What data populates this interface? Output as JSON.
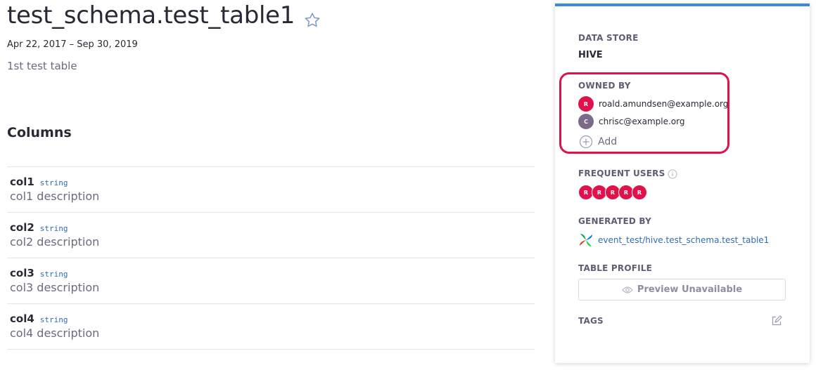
{
  "header": {
    "title": "test_schema.test_table1",
    "date_range": "Apr 22, 2017 – Sep 30, 2019",
    "description": "1st test table",
    "star_icon": "star-outline-icon"
  },
  "columns": {
    "heading": "Columns",
    "items": [
      {
        "name": "col1",
        "type": "string",
        "description": "col1 description"
      },
      {
        "name": "col2",
        "type": "string",
        "description": "col2 description"
      },
      {
        "name": "col3",
        "type": "string",
        "description": "col3 description"
      },
      {
        "name": "col4",
        "type": "string",
        "description": "col4 description"
      }
    ]
  },
  "panel": {
    "accent_color": "#3b8bd8",
    "data_store": {
      "label": "DATA STORE",
      "value": "HIVE"
    },
    "owned_by": {
      "label": "OWNED BY",
      "owners": [
        {
          "initial": "R",
          "email": "roald.amundsen@example.org",
          "color": "#e0114b"
        },
        {
          "initial": "C",
          "email": "chrisc@example.org",
          "color": "#7b6a8a"
        }
      ],
      "add_label": "Add",
      "highlight_color": "#e0114b"
    },
    "frequent_users": {
      "label": "FREQUENT USERS",
      "users": [
        "R",
        "R",
        "R",
        "R",
        "R"
      ]
    },
    "generated_by": {
      "label": "GENERATED BY",
      "link": "event_test/hive.test_schema.test_table1",
      "icon": "airflow-pinwheel-icon"
    },
    "table_profile": {
      "label": "TABLE PROFILE",
      "button": "Preview Unavailable"
    },
    "tags": {
      "label": "TAGS",
      "edit_icon": "edit-icon"
    }
  }
}
